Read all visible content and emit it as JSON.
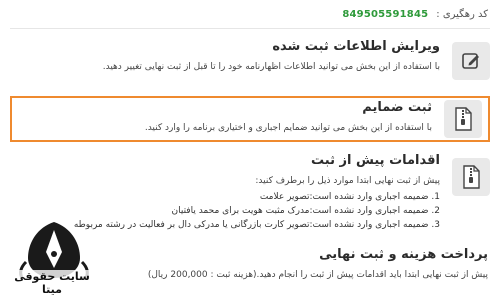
{
  "tracking": {
    "label": "کد رهگیری :",
    "code": "849505591845"
  },
  "sections": {
    "edit": {
      "title": "ویرایش اطلاعات ثبت شده",
      "desc": "با استفاده از این بخش می توانید اطلاعات اظهارنامه خود را تا قبل از ثبت نهایی تغییر دهید."
    },
    "attach": {
      "title": "ثبت ضمایم",
      "desc": "با استفاده از این بخش می توانید ضمایم اجباری و اختیاری برنامه را وارد کنید."
    },
    "pre": {
      "title": "اقدامات پیش از ثبت",
      "intro": "پیش از ثبت نهایی ابتدا موارد ذیل را برطرف کنید:",
      "steps": [
        "1. ضمیمه اجباری وارد نشده است:تصویر علامت",
        "2. ضمیمه اجباری وارد نشده است:مدرک مثبت هویت برای محمد یافتیان",
        "3. ضمیمه اجباری وارد نشده است:تصویر کارت بازرگانی یا مدرکی دال بر فعالیت در رشته مربوطه"
      ]
    },
    "pay": {
      "title": "پرداخت هزینه و ثبت نهایی",
      "desc": "پیش از ثبت نهایی ابتدا باید اقدامات پیش از ثبت را انجام دهید.(هزینه ثبت : 200,000 ریال)"
    }
  },
  "watermark": {
    "text": "سایت حقوقی میتا"
  },
  "colors": {
    "accent": "#ef8a2f",
    "code": "#2e9a3a",
    "icon_bg": "#e9e9e9"
  },
  "icons": {
    "edit": "pencil-edit-icon",
    "attach": "zip-file-icon",
    "pre": "zip-file-icon"
  }
}
